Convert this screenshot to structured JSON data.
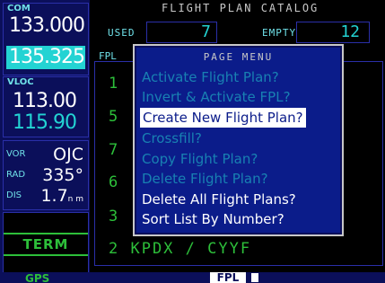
{
  "left_panel": {
    "com": {
      "label": "COM",
      "active": "133.000",
      "standby": "135.325"
    },
    "vloc": {
      "label": "VLOC",
      "active": "113.00",
      "standby": "115.90"
    },
    "nav": {
      "vor_label": "VOR",
      "vor_value": "OJC",
      "rad_label": "RAD",
      "rad_value": "335°",
      "dis_label": "DIS",
      "dis_value": "1.7",
      "dis_unit": "n m"
    },
    "term_label": "TERM"
  },
  "catalog": {
    "title": "FLIGHT PLAN CATALOG",
    "used_label": "USED",
    "used_value": "7",
    "empty_label": "EMPTY",
    "empty_value": "12",
    "fpl_label": "FPL",
    "rows": [
      {
        "text": "1"
      },
      {
        "text": "5"
      },
      {
        "text": "7"
      },
      {
        "text": "6"
      },
      {
        "text": "3"
      },
      {
        "text": "2 KPDX / CYYF"
      }
    ]
  },
  "page_menu": {
    "title": "PAGE MENU",
    "items": [
      {
        "label": "Activate Flight Plan?",
        "state": "dim"
      },
      {
        "label": "Invert & Activate FPL?",
        "state": "dim"
      },
      {
        "label": "Create New Flight Plan?",
        "state": "selected"
      },
      {
        "label": "Crossfill?",
        "state": "dim"
      },
      {
        "label": "Copy Flight Plan?",
        "state": "dim"
      },
      {
        "label": "Delete Flight Plan?",
        "state": "dim"
      },
      {
        "label": "Delete All Flight Plans?",
        "state": "enabled"
      },
      {
        "label": "Sort List By Number?",
        "state": "enabled"
      }
    ]
  },
  "status_bar": {
    "gps_label": "GPS",
    "fpl_label": "FPL"
  },
  "colors": {
    "panel_blue": "#0b0f5a",
    "menu_blue": "#0b1c8a",
    "cyan": "#23d3d3",
    "green": "#2dbf3a",
    "white": "#ffffff"
  }
}
